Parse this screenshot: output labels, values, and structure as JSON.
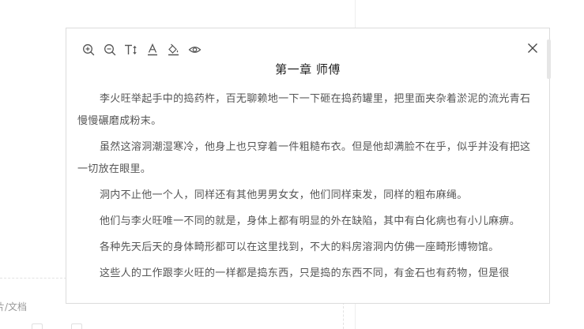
{
  "background": {
    "side_label": "片/文档"
  },
  "toolbar": {
    "icons": [
      "zoom-in-icon",
      "zoom-out-icon",
      "font-size-icon",
      "font-color-icon",
      "background-color-icon",
      "eye-icon"
    ],
    "close_icon": "close-icon"
  },
  "chapter": {
    "title": "第一章 师傅",
    "paragraphs": [
      "李火旺举起手中的捣药杵，百无聊赖地一下一下砸在捣药罐里，把里面夹杂着淤泥的流光青石慢慢碾磨成粉末。",
      "虽然这溶洞潮湿寒冷，他身上也只穿着一件粗糙布衣。但是他却满脸不在乎，似乎并没有把这一切放在眼里。",
      "洞内不止他一个人，同样还有其他男男女女，他们同样束发，同样的粗布麻绳。",
      "他们与李火旺唯一不同的就是，身体上都有明显的外在缺陷，其中有白化病也有小儿麻痹。",
      "各种先天后天的身体畸形都可以在这里找到，不大的料房溶洞内仿佛一座畸形博物馆。",
      "这些人的工作跟李火旺的一样都是捣东西，只是捣的东西不同，有金石也有药物，但是很"
    ]
  },
  "colors": {
    "text": "#555555",
    "title": "#222222",
    "icon": "#555555",
    "border": "#dcdcdc"
  }
}
